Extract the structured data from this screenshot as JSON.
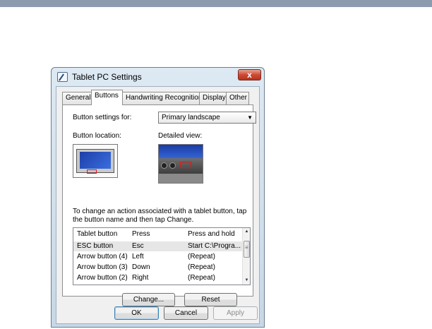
{
  "window": {
    "title": "Tablet PC Settings",
    "close_label": "x"
  },
  "tabs": [
    {
      "label": "General",
      "active": false
    },
    {
      "label": "Buttons",
      "active": true
    },
    {
      "label": "Handwriting Recognition",
      "active": false
    },
    {
      "label": "Display",
      "active": false
    },
    {
      "label": "Other",
      "active": false
    }
  ],
  "buttons_panel": {
    "settings_for_label": "Button settings for:",
    "settings_for_value": "Primary landscape",
    "location_label": "Button location:",
    "detailed_view_label": "Detailed view:",
    "instructions_line1": "To change an action associated with a tablet button, tap",
    "instructions_line2": "the button name and then tap Change."
  },
  "button_list": {
    "columns": [
      "Tablet button",
      "Press",
      "Press and hold"
    ],
    "rows": [
      {
        "button": "ESC button",
        "press": "Esc",
        "hold": "Start C:\\Progra...",
        "selected": true
      },
      {
        "button": "Arrow button (4)",
        "press": "Left",
        "hold": "(Repeat)",
        "selected": false
      },
      {
        "button": "Arrow button (3)",
        "press": "Down",
        "hold": "(Repeat)",
        "selected": false
      },
      {
        "button": "Arrow button (2)",
        "press": "Right",
        "hold": "(Repeat)",
        "selected": false
      }
    ]
  },
  "actions": {
    "change_label": "Change...",
    "reset_label": "Reset"
  },
  "dialog_buttons": {
    "ok_label": "OK",
    "cancel_label": "Cancel",
    "apply_label": "Apply"
  },
  "colors": {
    "title_bar": "#c7d7e6",
    "close_button": "#cc4a33",
    "selection": "#e6e6e6",
    "marker_red": "#e01818"
  }
}
